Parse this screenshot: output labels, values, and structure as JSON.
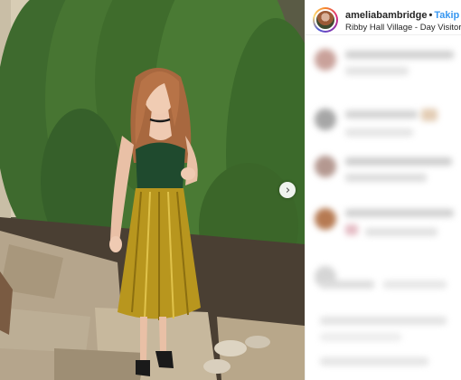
{
  "post": {
    "username": "ameliabambridge",
    "separator": "•",
    "follow_label": "Takip Et",
    "location": "Ribby Hall Village - Day Visitors"
  },
  "carousel": {
    "next_icon": "chevron-right-icon"
  },
  "colors": {
    "follow": "#3897f0",
    "text": "#262626",
    "border": "#efefef"
  }
}
